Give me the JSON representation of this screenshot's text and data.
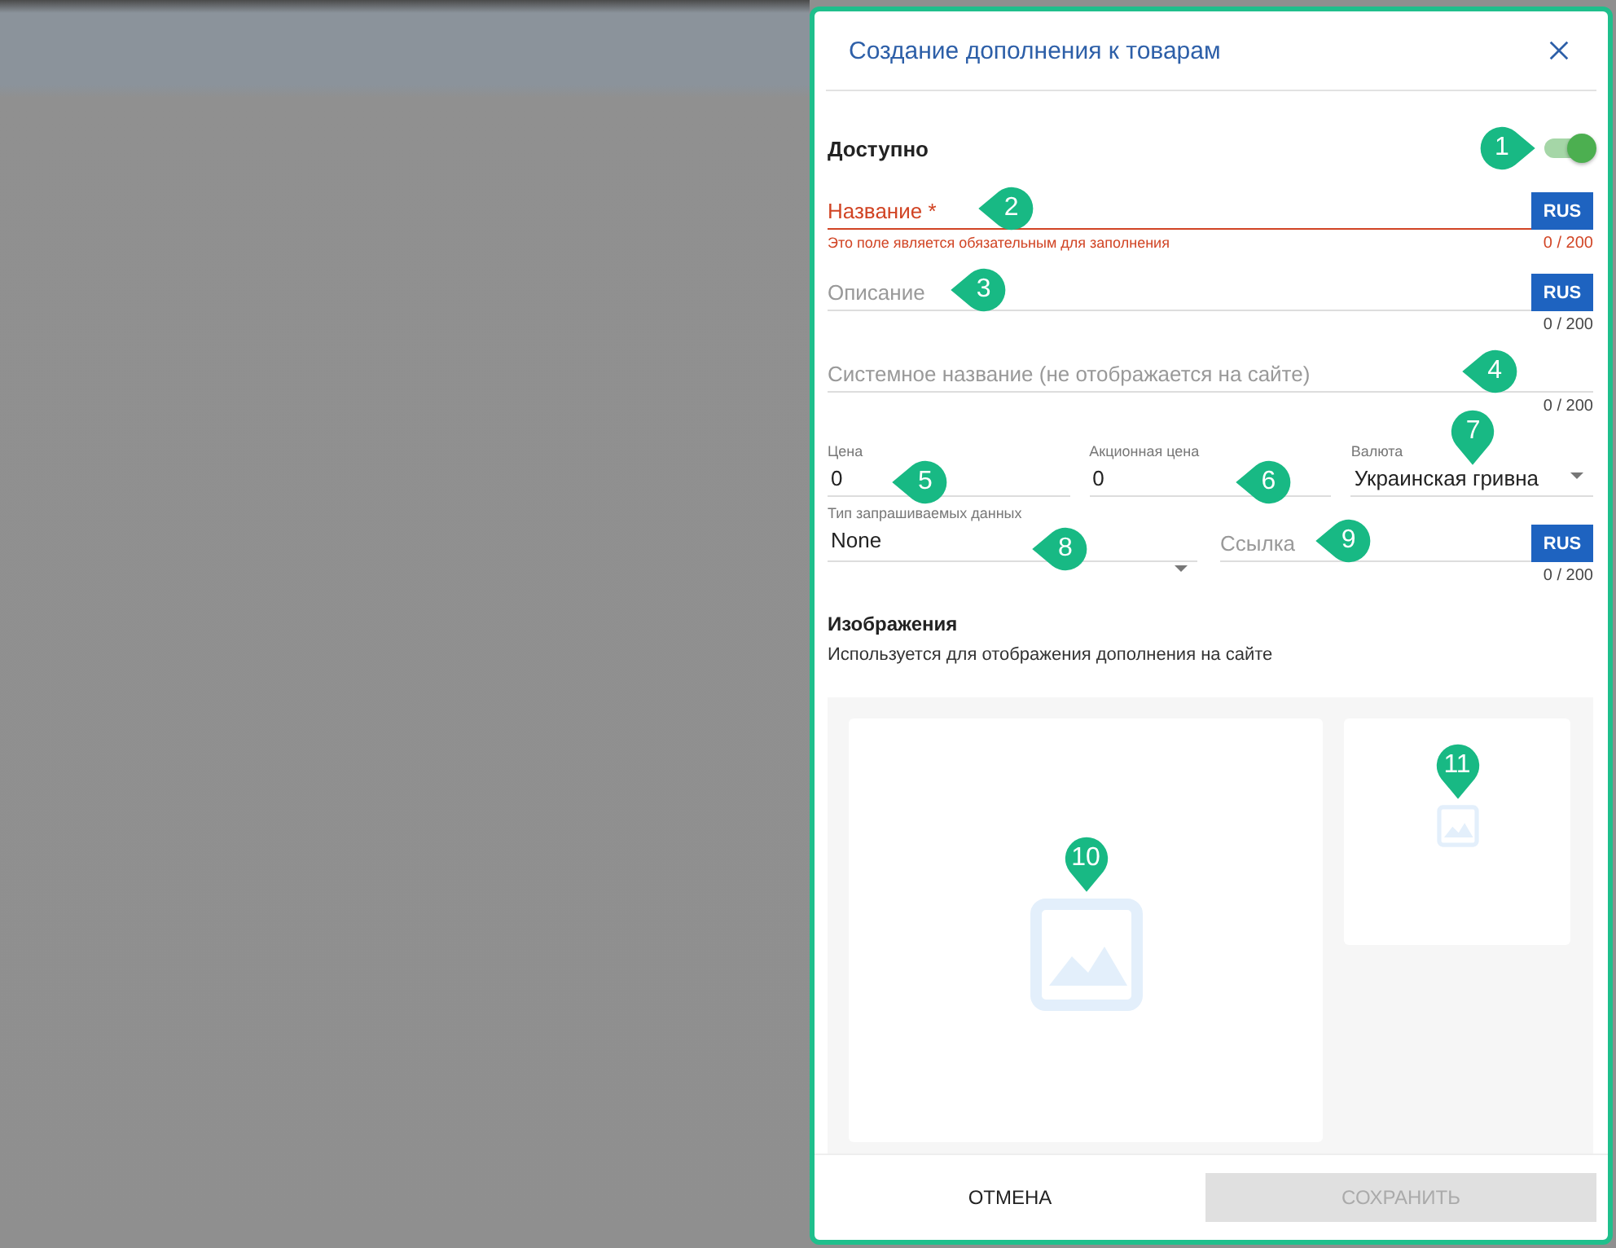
{
  "dialog": {
    "title": "Создание дополнения к товарам"
  },
  "available": {
    "label": "Доступно",
    "on": true,
    "marker": "1"
  },
  "text_fields": [
    {
      "placeholder": "Название *",
      "invalid": true,
      "error": "Это поле является обязательным для заполнения",
      "counter": "0 / 200",
      "lang": "RUS",
      "marker": "2"
    },
    {
      "placeholder": "Описание",
      "invalid": false,
      "counter": "0 / 200",
      "lang": "RUS",
      "marker": "3"
    },
    {
      "placeholder": "Системное название (не отображается на сайте)",
      "invalid": false,
      "counter": "0 / 200",
      "marker": "4"
    }
  ],
  "price_row": [
    {
      "kind": "number",
      "label": "Цена",
      "value": "0",
      "marker": "5"
    },
    {
      "kind": "number",
      "label": "Акционная цена",
      "value": "0",
      "marker": "6"
    },
    {
      "kind": "select",
      "label": "Валюта",
      "value": "Украинская гривна",
      "marker": "7"
    }
  ],
  "data_type": {
    "label": "Тип запрашиваемых данных",
    "value": "None",
    "marker": "8"
  },
  "link_field": {
    "placeholder": "Ссылка",
    "lang": "RUS",
    "counter": "0 / 200",
    "marker": "9"
  },
  "images": {
    "title": "Изображения",
    "description": "Используется для отображения дополнения на сайте",
    "slots": [
      {
        "kind": "main",
        "marker": "10"
      },
      {
        "kind": "thumb",
        "marker": "11"
      }
    ]
  },
  "buttons": [
    {
      "label": "ОТМЕНА",
      "disabled": false
    },
    {
      "label": "СОХРАНИТЬ",
      "disabled": true
    }
  ]
}
